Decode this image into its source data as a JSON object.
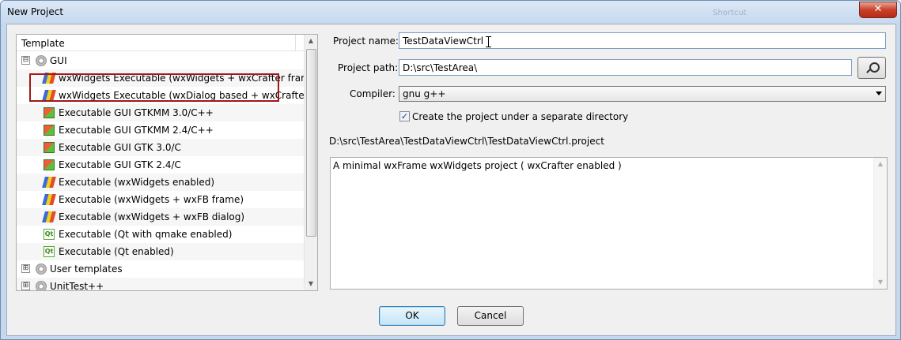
{
  "window": {
    "title": "New Project",
    "close_glyph": "✕",
    "background_text": "Shortcut"
  },
  "tree": {
    "header": "Template",
    "items": [
      {
        "label": "GUI",
        "expander": "⊟",
        "icon": "gear-icon"
      },
      {
        "label": "wxWidgets Executable (wxWidgets + wxCrafter frame)",
        "icon": "wxwidgets-icon"
      },
      {
        "label": "wxWidgets Executable (wxDialog based + wxCrafter)",
        "icon": "wxwidgets-icon"
      },
      {
        "label": "Executable GUI GTKMM 3.0/C++",
        "icon": "cube-icon"
      },
      {
        "label": "Executable GUI GTKMM 2.4/C++",
        "icon": "cube-icon"
      },
      {
        "label": "Executable GUI GTK 3.0/C",
        "icon": "cube-icon"
      },
      {
        "label": "Executable GUI GTK 2.4/C",
        "icon": "cube-icon"
      },
      {
        "label": "Executable (wxWidgets enabled)",
        "icon": "wxwidgets-icon"
      },
      {
        "label": "Executable (wxWidgets + wxFB frame)",
        "icon": "wxwidgets-icon"
      },
      {
        "label": "Executable (wxWidgets + wxFB dialog)",
        "icon": "wxwidgets-icon"
      },
      {
        "label": "Executable (Qt with qmake enabled)",
        "icon": "qt-icon"
      },
      {
        "label": "Executable (Qt enabled)",
        "icon": "qt-icon"
      },
      {
        "label": "User templates",
        "expander": "⊞",
        "icon": "gear-icon"
      },
      {
        "label": "UnitTest++",
        "expander": "⊞",
        "icon": "gear-icon"
      }
    ]
  },
  "form": {
    "project_name_label": "Project name:",
    "project_name_value": "TestDataViewCtrl",
    "project_path_label": "Project path:",
    "project_path_value": "D:\\src\\TestArea\\",
    "compiler_label": "Compiler:",
    "compiler_value": "gnu g++",
    "separate_dir_label": "Create the project under a separate directory",
    "separate_dir_checked": "✓",
    "full_path": "D:\\src\\TestArea\\TestDataViewCtrl\\TestDataViewCtrl.project",
    "description": "A minimal wxFrame wxWidgets project ( wxCrafter enabled )"
  },
  "buttons": {
    "ok": "OK",
    "cancel": "Cancel"
  }
}
